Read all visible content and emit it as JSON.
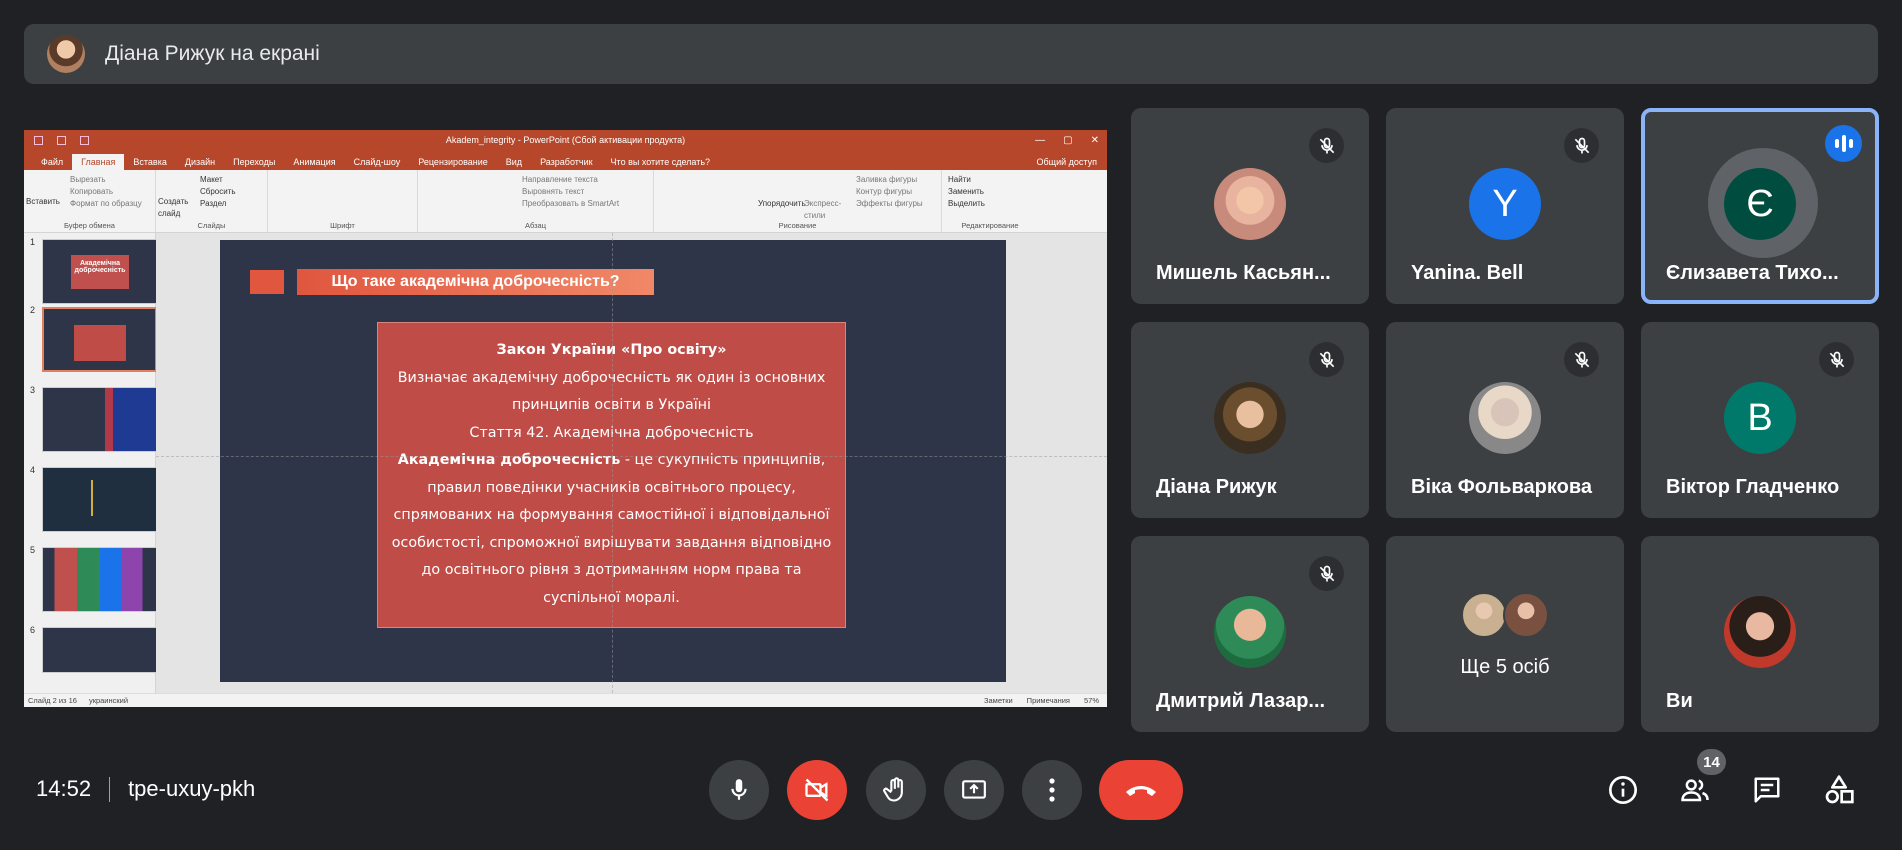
{
  "banner": {
    "text": "Діана Рижук на екрані"
  },
  "powerpoint": {
    "window_title": "Akadem_integrity - PowerPoint (Сбой активации продукта)",
    "tabs": [
      "Файл",
      "Главная",
      "Вставка",
      "Дизайн",
      "Переходы",
      "Анимация",
      "Слайд-шоу",
      "Рецензирование",
      "Вид",
      "Разработчик",
      "Что вы хотите сделать?"
    ],
    "share_label": "Общий доступ",
    "ribbon": {
      "clipboard": {
        "paste": "Вставить",
        "cut": "Вырезать",
        "copy": "Копировать",
        "format": "Формат по образцу",
        "group": "Буфер обмена"
      },
      "slides": {
        "new": "Создать слайд",
        "layout": "Макет",
        "reset": "Сбросить",
        "section": "Раздел",
        "group": "Слайды"
      },
      "font": {
        "group": "Шрифт"
      },
      "paragraph": {
        "dir": "Направление текста",
        "align": "Выровнять текст",
        "smartart": "Преобразовать в SmartArt",
        "group": "Абзац"
      },
      "drawing": {
        "arrange": "Упорядочить",
        "styles": "Экспресс-стили",
        "fill": "Заливка фигуры",
        "outline": "Контур фигуры",
        "effects": "Эффекты фигуры",
        "group": "Рисование"
      },
      "editing": {
        "find": "Найти",
        "replace": "Заменить",
        "select": "Выделить",
        "group": "Редактирование"
      }
    },
    "thumbnails": [
      "1",
      "2",
      "3",
      "4",
      "5",
      "6"
    ],
    "thumb1_text": "Академічна доброчесність",
    "slide": {
      "header": "Що таке академічна доброчесність?",
      "line1": "Закон України «Про освіту»",
      "line2": "Визначає академічну доброчесність як один із основних принципів освіти в Україні",
      "line3": "Стаття 42. Академічна доброчесність",
      "line4_bold": "Академічна доброчесність",
      "line4_rest": " - це сукупність принципів, правил поведінки учасників освітнього процесу, спрямованих на формування самостійної і відповідальної особистості, спроможної вирішувати завдання відповідно до освітнього рівня з дотриманням норм права та суспільної моралі."
    },
    "status": {
      "slide": "Слайд 2 из 16",
      "lang": "украинский",
      "notes": "Заметки",
      "comments": "Примечания",
      "zoom": "57%"
    }
  },
  "participants": [
    {
      "name": "Мишель Касьян...",
      "muted": true
    },
    {
      "name": "Yanina. Bell",
      "initial": "Y",
      "color": "#1a73e8",
      "muted": true
    },
    {
      "name": "Єлизавета Тихо...",
      "initial": "Є",
      "color": "#004d40",
      "speaking": true
    },
    {
      "name": "Діана Рижук",
      "muted": true
    },
    {
      "name": "Віка Фольваркова",
      "muted": true
    },
    {
      "name": "Віктор Гладченко",
      "initial": "B",
      "color": "#00796b",
      "muted": true
    },
    {
      "name": "Дмитрий Лазар...",
      "muted": true
    },
    {
      "name": "Ще 5 осіб"
    },
    {
      "name": "Ви"
    }
  ],
  "meeting": {
    "time": "14:52",
    "code": "tpe-uxuy-pkh",
    "participant_count": "14"
  },
  "colors": {
    "background": "#202124",
    "tile": "#3c4043",
    "red": "#ea4335",
    "speaking": "#8ab4f8"
  }
}
